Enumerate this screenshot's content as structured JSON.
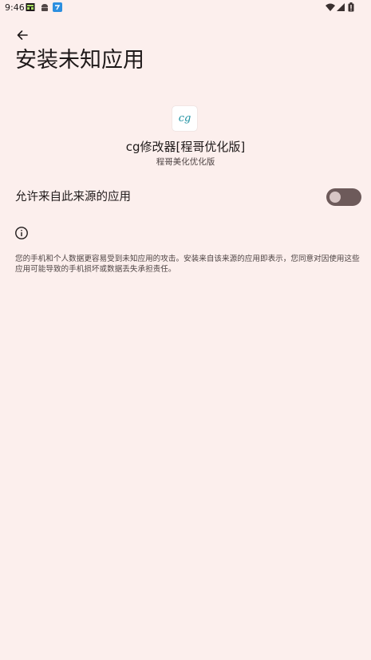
{
  "status_bar": {
    "time": "9:46",
    "left_icons": [
      "calendar-app-icon",
      "android-icon",
      "app-notification-icon"
    ],
    "right_icons": [
      "wifi-icon",
      "signal-icon",
      "battery-icon"
    ]
  },
  "header": {
    "title": "安装未知应用"
  },
  "app": {
    "icon_text": "cg",
    "name": "cg修改器[程哥优化版]",
    "subtitle": "程哥美化优化版"
  },
  "setting": {
    "label": "允许来自此来源的应用",
    "enabled": false
  },
  "info": {
    "text": "您的手机和个人数据更容易受到未知应用的攻击。安装来自该来源的应用即表示，您同意对因使用这些应用可能导致的手机损坏或数据丢失承担责任。"
  },
  "colors": {
    "background": "#fcefed",
    "toggle_track": "#6d5a5a",
    "toggle_thumb": "#d8c6c5",
    "app_icon_text": "#1b8fa0"
  }
}
